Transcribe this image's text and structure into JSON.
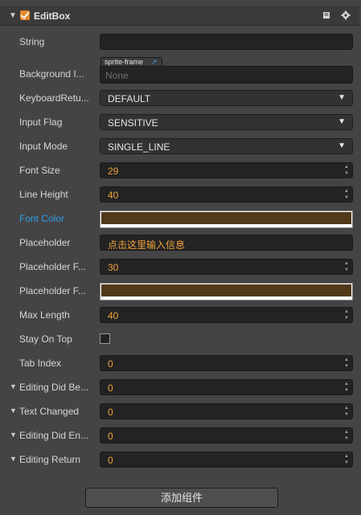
{
  "component": {
    "title": "EditBox",
    "enabled": true,
    "icons": [
      "book-icon",
      "gear-icon"
    ]
  },
  "props": {
    "string": {
      "label": "String",
      "value": ""
    },
    "background_image": {
      "label": "Background I...",
      "type_tag": "sprite-frame",
      "value": "None"
    },
    "keyboard_return": {
      "label": "KeyboardRetu...",
      "value": "DEFAULT"
    },
    "input_flag": {
      "label": "Input Flag",
      "value": "SENSITIVE"
    },
    "input_mode": {
      "label": "Input Mode",
      "value": "SINGLE_LINE"
    },
    "font_size": {
      "label": "Font Size",
      "value": "29"
    },
    "line_height": {
      "label": "Line Height",
      "value": "40"
    },
    "font_color": {
      "label": "Font Color",
      "color": "#51391a"
    },
    "placeholder": {
      "label": "Placeholder",
      "value": "点击这里输入信息"
    },
    "placeholder_font_size": {
      "label": "Placeholder F...",
      "value": "30"
    },
    "placeholder_font_color": {
      "label": "Placeholder F...",
      "color": "#51391a"
    },
    "max_length": {
      "label": "Max Length",
      "value": "40"
    },
    "stay_on_top": {
      "label": "Stay On Top",
      "checked": false
    },
    "tab_index": {
      "label": "Tab Index",
      "value": "0"
    }
  },
  "events": [
    {
      "label": "Editing Did Be...",
      "value": "0"
    },
    {
      "label": "Text Changed",
      "value": "0"
    },
    {
      "label": "Editing Did En...",
      "value": "0"
    },
    {
      "label": "Editing Return",
      "value": "0"
    }
  ],
  "add_component_label": "添加组件",
  "colors": {
    "accent": "#e3892d",
    "number": "#f0a23b",
    "label_highlight": "#2f9ee8"
  }
}
